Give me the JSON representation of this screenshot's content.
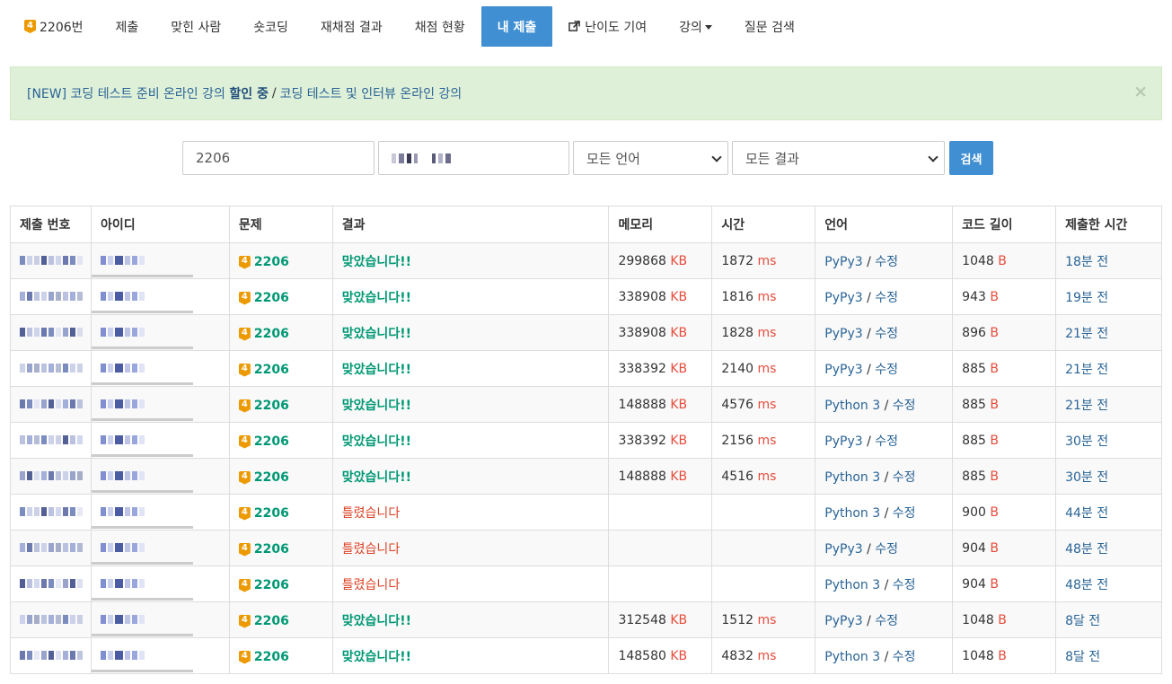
{
  "nav": {
    "problem": {
      "tier": "4",
      "label": "2206번"
    },
    "items": [
      "제출",
      "맞힌 사람",
      "숏코딩",
      "재채점 결과",
      "채점 현황"
    ],
    "active": "내 제출",
    "contribute": "난이도 기여",
    "lecture": "강의",
    "qna": "질문 검색"
  },
  "alert": {
    "part1": "[NEW] 코딩 테스트 준비 온라인 강의 ",
    "bold": "할인 중",
    "sep": "/",
    "part2": "코딩 테스트 및 인터뷰 온라인 강의",
    "close": "×"
  },
  "search": {
    "problem_id": "2206",
    "language": "모든 언어",
    "result": "모든 결과",
    "button": "검색"
  },
  "table": {
    "headers": [
      "제출 번호",
      "아이디",
      "문제",
      "결과",
      "메모리",
      "시간",
      "언어",
      "코드 길이",
      "제출한 시간"
    ],
    "unit_kb": "KB",
    "unit_ms": "ms",
    "unit_b": "B",
    "edit": "수정",
    "tier": "4",
    "rows": [
      {
        "problem": "2206",
        "result": "맞았습니다!!",
        "status": "ac",
        "memory": "299868",
        "time": "1872",
        "lang": "PyPy3",
        "length": "1048",
        "ago": "18분 전"
      },
      {
        "problem": "2206",
        "result": "맞았습니다!!",
        "status": "ac",
        "memory": "338908",
        "time": "1816",
        "lang": "PyPy3",
        "length": "943",
        "ago": "19분 전"
      },
      {
        "problem": "2206",
        "result": "맞았습니다!!",
        "status": "ac",
        "memory": "338908",
        "time": "1828",
        "lang": "PyPy3",
        "length": "896",
        "ago": "21분 전"
      },
      {
        "problem": "2206",
        "result": "맞았습니다!!",
        "status": "ac",
        "memory": "338392",
        "time": "2140",
        "lang": "PyPy3",
        "length": "885",
        "ago": "21분 전"
      },
      {
        "problem": "2206",
        "result": "맞았습니다!!",
        "status": "ac",
        "memory": "148888",
        "time": "4576",
        "lang": "Python 3",
        "length": "885",
        "ago": "21분 전"
      },
      {
        "problem": "2206",
        "result": "맞았습니다!!",
        "status": "ac",
        "memory": "338392",
        "time": "2156",
        "lang": "PyPy3",
        "length": "885",
        "ago": "30분 전"
      },
      {
        "problem": "2206",
        "result": "맞았습니다!!",
        "status": "ac",
        "memory": "148888",
        "time": "4516",
        "lang": "Python 3",
        "length": "885",
        "ago": "30분 전"
      },
      {
        "problem": "2206",
        "result": "틀렸습니다",
        "status": "wa",
        "memory": "",
        "time": "",
        "lang": "Python 3",
        "length": "900",
        "ago": "44분 전"
      },
      {
        "problem": "2206",
        "result": "틀렸습니다",
        "status": "wa",
        "memory": "",
        "time": "",
        "lang": "PyPy3",
        "length": "904",
        "ago": "48분 전"
      },
      {
        "problem": "2206",
        "result": "틀렸습니다",
        "status": "wa",
        "memory": "",
        "time": "",
        "lang": "Python 3",
        "length": "904",
        "ago": "48분 전"
      },
      {
        "problem": "2206",
        "result": "맞았습니다!!",
        "status": "ac",
        "memory": "312548",
        "time": "1512",
        "lang": "PyPy3",
        "length": "1048",
        "ago": "8달 전"
      },
      {
        "problem": "2206",
        "result": "맞았습니다!!",
        "status": "ac",
        "memory": "148580",
        "time": "4832",
        "lang": "Python 3",
        "length": "1048",
        "ago": "8달 전"
      }
    ]
  },
  "colors": {
    "accent": "#3f8fd2",
    "correct": "#009874",
    "wrong": "#dd4124",
    "unit": "#e74c3c",
    "link": "#2a6496",
    "tier": "#ec9a00"
  }
}
